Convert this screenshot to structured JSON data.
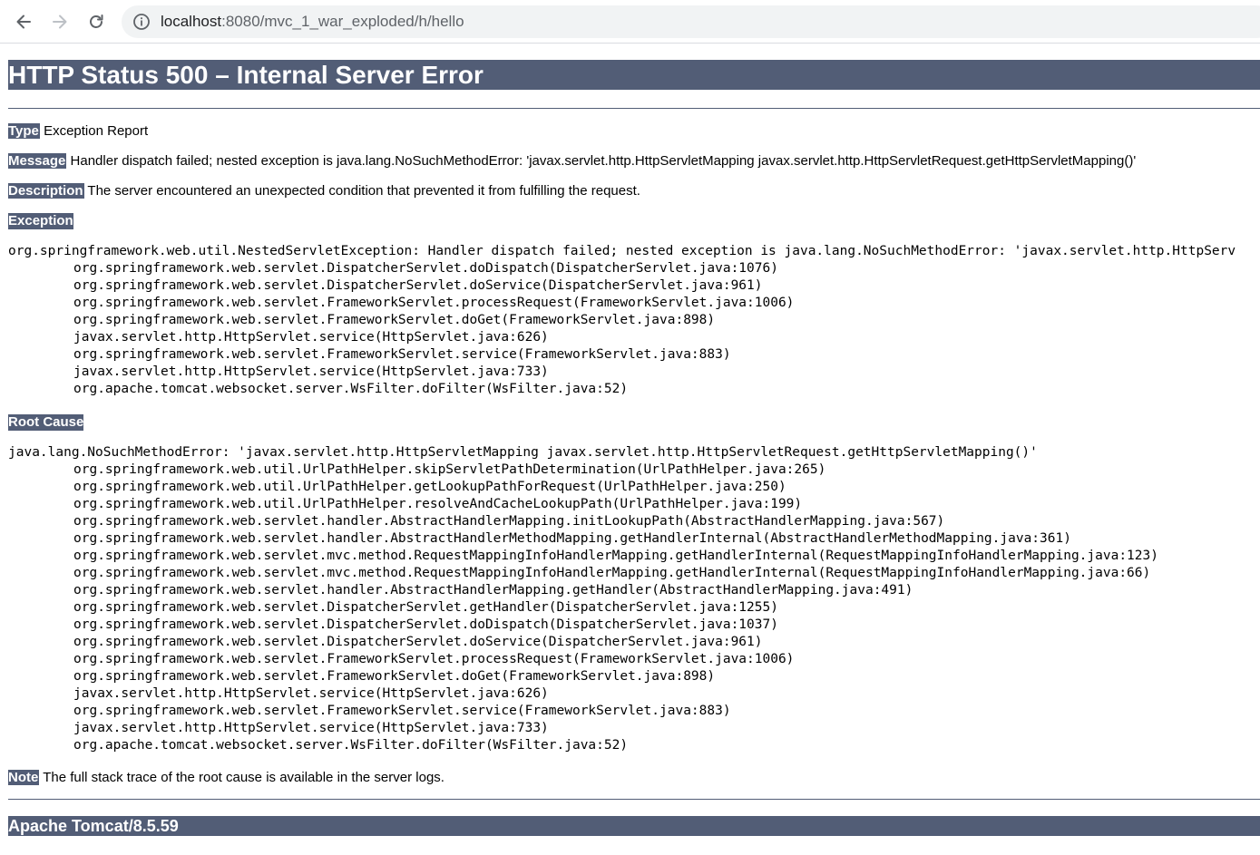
{
  "browser": {
    "url_host": "localhost",
    "url_path": ":8080/mvc_1_war_exploded/h/hello",
    "icons": [
      "back-icon",
      "forward-icon",
      "reload-icon",
      "info-icon"
    ]
  },
  "page": {
    "title": "HTTP Status 500 – Internal Server Error",
    "type_label": "Type",
    "type_value": " Exception Report",
    "message_label": "Message",
    "message_value": " Handler dispatch failed; nested exception is java.lang.NoSuchMethodError: 'javax.servlet.http.HttpServletMapping javax.servlet.http.HttpServletRequest.getHttpServletMapping()'",
    "description_label": "Description",
    "description_value": " The server encountered an unexpected condition that prevented it from fulfilling the request.",
    "exception_heading": "Exception",
    "exception_trace": [
      "org.springframework.web.util.NestedServletException: Handler dispatch failed; nested exception is java.lang.NoSuchMethodError: 'javax.servlet.http.HttpServ",
      "org.springframework.web.servlet.DispatcherServlet.doDispatch(DispatcherServlet.java:1076)",
      "org.springframework.web.servlet.DispatcherServlet.doService(DispatcherServlet.java:961)",
      "org.springframework.web.servlet.FrameworkServlet.processRequest(FrameworkServlet.java:1006)",
      "org.springframework.web.servlet.FrameworkServlet.doGet(FrameworkServlet.java:898)",
      "javax.servlet.http.HttpServlet.service(HttpServlet.java:626)",
      "org.springframework.web.servlet.FrameworkServlet.service(FrameworkServlet.java:883)",
      "javax.servlet.http.HttpServlet.service(HttpServlet.java:733)",
      "org.apache.tomcat.websocket.server.WsFilter.doFilter(WsFilter.java:52)"
    ],
    "root_cause_heading": "Root Cause",
    "root_cause_trace": [
      "java.lang.NoSuchMethodError: 'javax.servlet.http.HttpServletMapping javax.servlet.http.HttpServletRequest.getHttpServletMapping()'",
      "org.springframework.web.util.UrlPathHelper.skipServletPathDetermination(UrlPathHelper.java:265)",
      "org.springframework.web.util.UrlPathHelper.getLookupPathForRequest(UrlPathHelper.java:250)",
      "org.springframework.web.util.UrlPathHelper.resolveAndCacheLookupPath(UrlPathHelper.java:199)",
      "org.springframework.web.servlet.handler.AbstractHandlerMapping.initLookupPath(AbstractHandlerMapping.java:567)",
      "org.springframework.web.servlet.handler.AbstractHandlerMethodMapping.getHandlerInternal(AbstractHandlerMethodMapping.java:361)",
      "org.springframework.web.servlet.mvc.method.RequestMappingInfoHandlerMapping.getHandlerInternal(RequestMappingInfoHandlerMapping.java:123)",
      "org.springframework.web.servlet.mvc.method.RequestMappingInfoHandlerMapping.getHandlerInternal(RequestMappingInfoHandlerMapping.java:66)",
      "org.springframework.web.servlet.handler.AbstractHandlerMapping.getHandler(AbstractHandlerMapping.java:491)",
      "org.springframework.web.servlet.DispatcherServlet.getHandler(DispatcherServlet.java:1255)",
      "org.springframework.web.servlet.DispatcherServlet.doDispatch(DispatcherServlet.java:1037)",
      "org.springframework.web.servlet.DispatcherServlet.doService(DispatcherServlet.java:961)",
      "org.springframework.web.servlet.FrameworkServlet.processRequest(FrameworkServlet.java:1006)",
      "org.springframework.web.servlet.FrameworkServlet.doGet(FrameworkServlet.java:898)",
      "javax.servlet.http.HttpServlet.service(HttpServlet.java:626)",
      "org.springframework.web.servlet.FrameworkServlet.service(FrameworkServlet.java:883)",
      "javax.servlet.http.HttpServlet.service(HttpServlet.java:733)",
      "org.apache.tomcat.websocket.server.WsFilter.doFilter(WsFilter.java:52)"
    ],
    "note_label": "Note",
    "note_value": " The full stack trace of the root cause is available in the server logs.",
    "footer": "Apache Tomcat/8.5.59"
  },
  "colors": {
    "header_bg": "#525d76",
    "header_text": "#ffffff",
    "omnibox_bg": "#f1f3f4"
  }
}
